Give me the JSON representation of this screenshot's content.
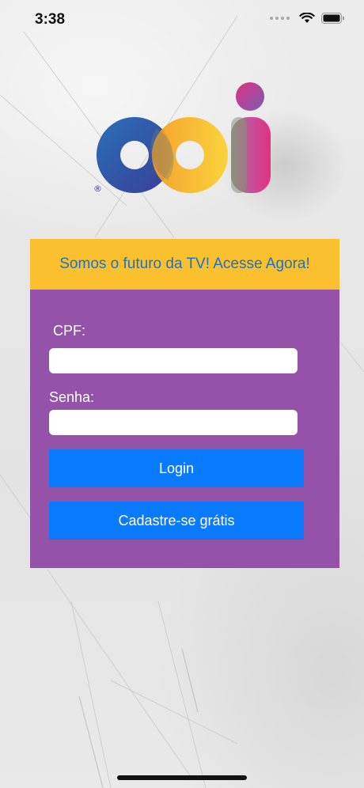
{
  "status_bar": {
    "time": "3:38"
  },
  "logo": {
    "registered_mark": "®",
    "colors": {
      "blue": "#2f4fa0",
      "orange": "#f7a21d",
      "yellow": "#fbd12c",
      "magenta": "#d9338f",
      "purple": "#8e5bb0"
    }
  },
  "banner": {
    "text": "Somos o futuro da TV! Acesse Agora!"
  },
  "form": {
    "cpf_label": "CPF:",
    "cpf_value": "",
    "password_label": "Senha:",
    "password_value": "",
    "login_button": "Login",
    "signup_button": "Cadastre-se grátis"
  },
  "colors": {
    "banner_bg": "#fbc02d",
    "banner_text": "#1a73c9",
    "card_bg": "#9452a8",
    "button_bg": "#0a7bff"
  }
}
